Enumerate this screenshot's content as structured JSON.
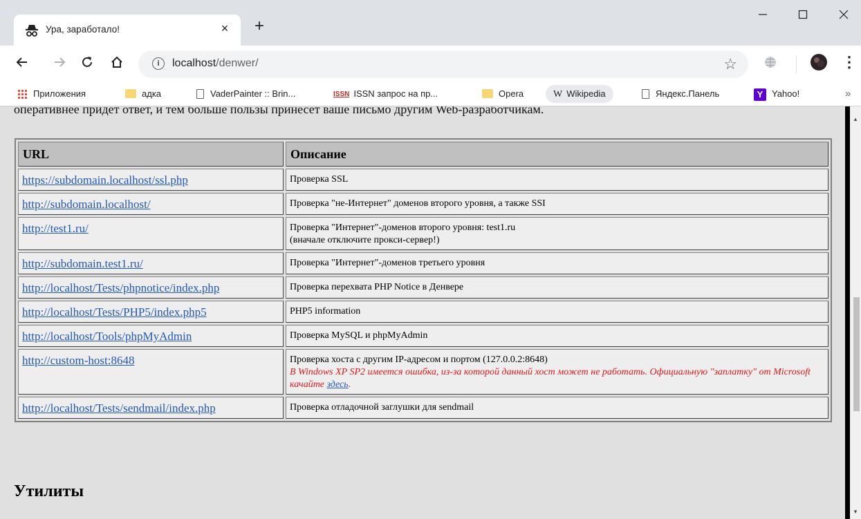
{
  "browser": {
    "tab_title": "Ура, заработало!",
    "tab_close": "×",
    "new_tab": "+",
    "window_controls": {
      "minimize": "—",
      "maximize": "☐",
      "close": "✕"
    },
    "url_host": "localhost",
    "url_path": "/denwer/",
    "info_icon": "i",
    "star": "☆",
    "more": "⋮"
  },
  "bookmarks": [
    {
      "label": "Приложения",
      "icon": "apps-grid-icon"
    },
    {
      "label": "адка",
      "icon": "folder-icon"
    },
    {
      "label": "VaderPainter :: Brin...",
      "icon": "page-icon"
    },
    {
      "label": "ISSN запрос на пр...",
      "icon": "issn-icon"
    },
    {
      "label": "Opera",
      "icon": "folder-icon"
    },
    {
      "label": "Wikipedia",
      "icon": "wikipedia-icon"
    },
    {
      "label": "Яндекс.Панель",
      "icon": "page-icon"
    },
    {
      "label": "Yahoo!",
      "icon": "yahoo-icon"
    }
  ],
  "bookmarks_overflow": "»",
  "page": {
    "intro": "оперативнее придет ответ, и тем больше пользы принесет ваше письмо другим Web-разработчикам.",
    "table": {
      "headers": [
        "URL",
        "Описание"
      ],
      "rows": [
        {
          "url": "https://subdomain.localhost/ssl.php",
          "desc": "Проверка SSL"
        },
        {
          "url": "http://subdomain.localhost/",
          "desc": "Проверка \"не-Интернет\" доменов второго уровня, а также SSI"
        },
        {
          "url": "http://test1.ru/",
          "desc": "Проверка \"Интернет\"-доменов второго уровня: test1.ru",
          "desc2": "(вначале отключите прокси-сервер!)"
        },
        {
          "url": "http://subdomain.test1.ru/",
          "desc": "Проверка \"Интернет\"-доменов третьего уровня"
        },
        {
          "url": "http://localhost/Tests/phpnotice/index.php",
          "desc": "Проверка перехвата PHP Notice в Денвере"
        },
        {
          "url": "http://localhost/Tests/PHP5/index.php5",
          "desc": "PHP5 information"
        },
        {
          "url": "http://localhost/Tools/phpMyAdmin",
          "desc": "Проверка MySQL и phpMyAdmin"
        },
        {
          "url": "http://custom-host:8648",
          "desc": "Проверка хоста с другим IP-адресом и портом (127.0.0.2:8648)",
          "warn": "В Windows XP SP2 имеется ошибка, из-за которой данный хост может не работать. Официальную \"заплатку\" от Microsoft качайте ",
          "warn_link": "здесь",
          "warn_end": "."
        },
        {
          "url": "http://localhost/Tests/sendmail/index.php",
          "desc": "Проверка отладочной заглушки для sendmail"
        }
      ]
    },
    "utilities_heading": "Утилиты"
  },
  "colors": {
    "link": "#2359b5",
    "warning": "#e0191c",
    "page_bg": "#e0e0e0",
    "header_bg": "#c0c0c0"
  }
}
